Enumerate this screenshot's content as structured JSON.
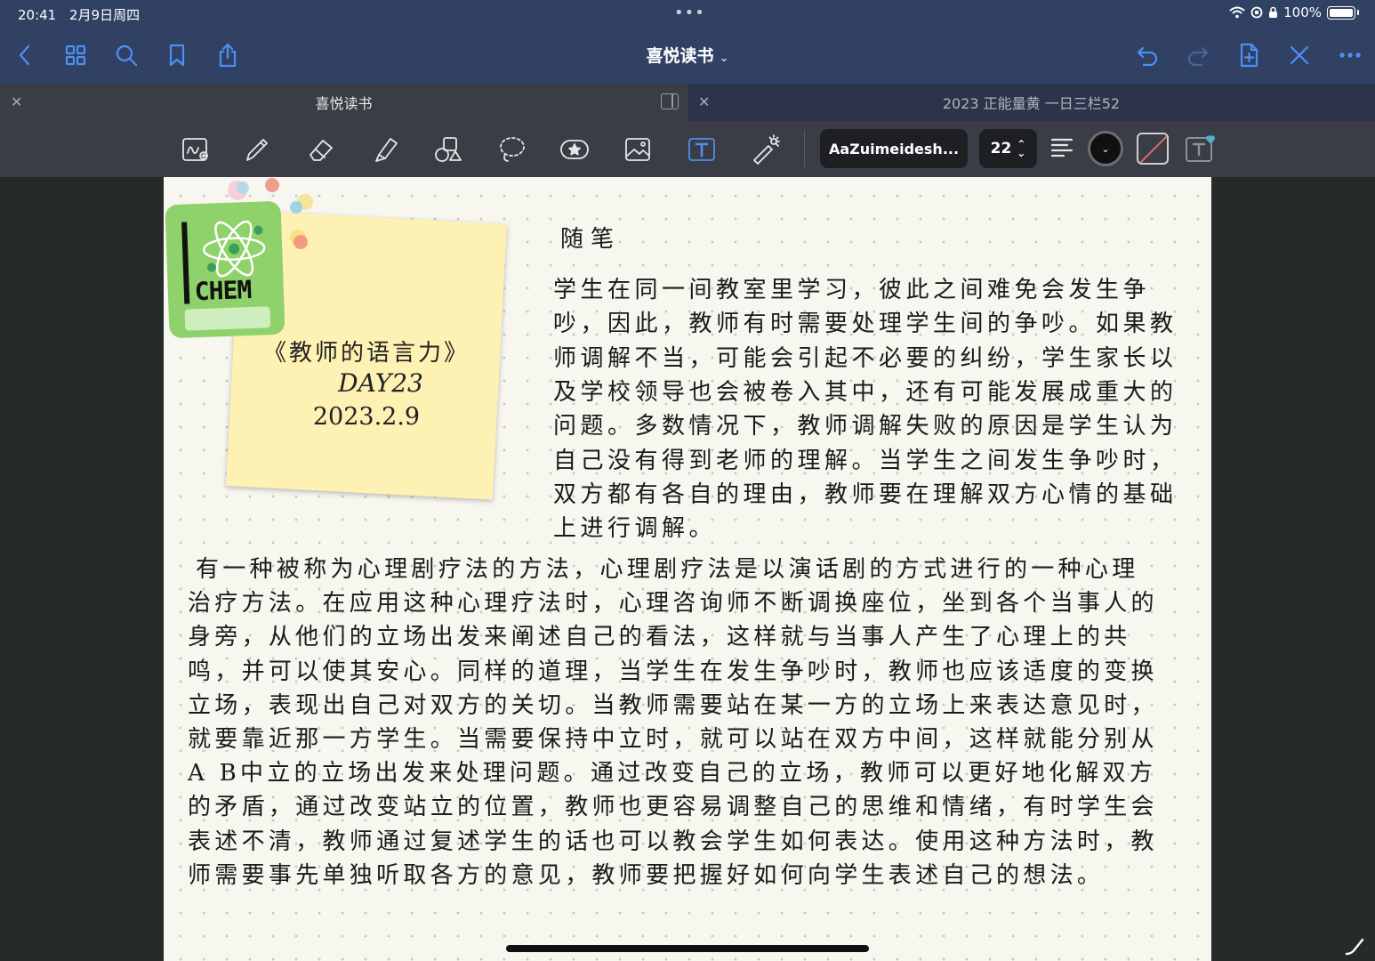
{
  "status_bar": {
    "time": "20:41",
    "date": "2月9日周四",
    "battery": "100%"
  },
  "nav": {
    "title": "喜悦读书"
  },
  "tabs": [
    {
      "label": "喜悦读书",
      "active": true
    },
    {
      "label": "2023 正能量黄 一日三栏52",
      "active": false
    }
  ],
  "toolbar": {
    "font_name": "AaZuimeidesh...",
    "font_size": "22"
  },
  "colors": {
    "accent": "#4f8ff5",
    "nav_bg": "#304163",
    "toolbar_bg": "#3a3d45",
    "page_bg": "#f7f6ef"
  },
  "sticker": {
    "chem_label": "CHEM",
    "book_title": "《教师的语言力》",
    "day": "DAY23",
    "date": "2023.2.9"
  },
  "note": {
    "heading": "随笔",
    "para1": [
      " 学生在同一间教室里学习，彼此之间难免会发生争",
      "吵，因此，教师有时需要处理学生间的争吵。如果教",
      "师调解不当，可能会引起不必要的纠纷，学生家长以",
      "及学校领导也会被卷入其中，还有可能发展成重大的",
      "问题。多数情况下，教师调解失败的原因是学生认为",
      "自己没有得到老师的理解。当学生之间发生争吵时，",
      "双方都有各自的理由，教师要在理解双方心情的基础",
      "上进行调解。"
    ],
    "para2": [
      "有一种被称为心理剧疗法的方法，心理剧疗法是以演话剧的方式进行的一种心理",
      "治疗方法。在应用这种心理疗法时，心理咨询师不断调换座位，坐到各个当事人的",
      "身旁，从他们的立场出发来阐述自己的看法，这样就与当事人产生了心理上的共",
      "鸣，并可以使其安心。同样的道理，当学生在发生争吵时，教师也应该适度的变换",
      "立场，表现出自己对双方的关切。当教师需要站在某一方的立场上来表达意见时，",
      "就要靠近那一方学生。当需要保持中立时，就可以站在双方中间，这样就能分别从",
      "A B中立的立场出发来处理问题。通过改变自己的立场，教师可以更好地化解双方",
      "的矛盾，通过改变站立的位置，教师也更容易调整自己的思维和情绪，有时学生会",
      "表述不清，教师通过复述学生的话也可以教会学生如何表达。使用这种方法时，教",
      "师需要事先单独听取各方的意见，教师要把握好如何向学生表述自己的想法。"
    ]
  }
}
